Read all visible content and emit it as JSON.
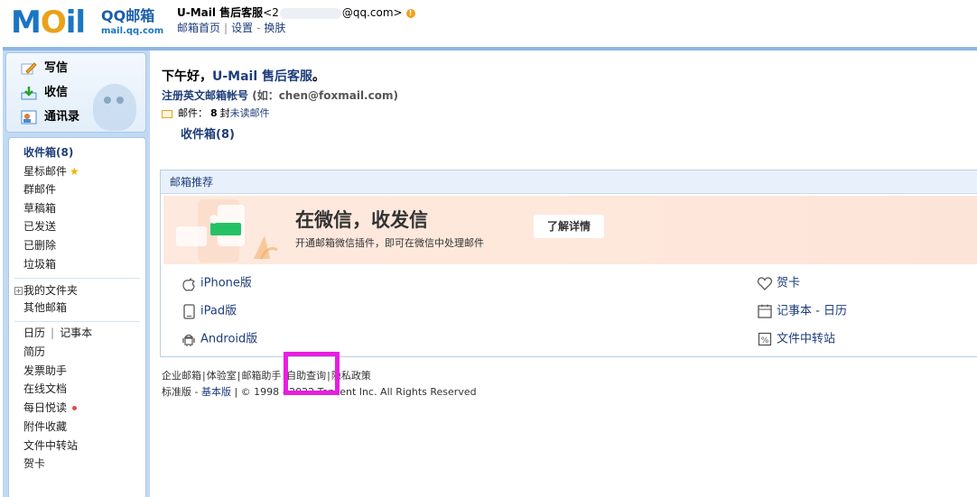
{
  "logo": {
    "letters_blue1": "M",
    "letters_o": "O",
    "letters_blue2": "il",
    "title": "QQ邮箱",
    "url": "mail.qq.com"
  },
  "account": {
    "name": "U-Mail 售后客服",
    "email_prefix": "<2",
    "email_suffix": "@qq.com>"
  },
  "header_links": [
    "邮箱首页",
    "设置",
    "换肤"
  ],
  "nav_top": {
    "compose": "写信",
    "receive": "收信",
    "contacts": "通讯录"
  },
  "nav_list": {
    "inbox": "收件箱(8)",
    "starred": "星标邮件",
    "group": "群邮件",
    "drafts": "草稿箱",
    "sent": "已发送",
    "deleted": "已删除",
    "spam": "垃圾箱",
    "my_folders": "我的文件夹",
    "other_mail": "其他邮箱",
    "calendar": "日历",
    "notes": "记事本",
    "resume": "简历",
    "invoice": "发票助手",
    "online_docs": "在线文档",
    "daily_read": "每日悦读",
    "attachments": "附件收藏",
    "file_transfer": "文件中转站",
    "cards": "贺卡"
  },
  "main": {
    "greeting_prefix": "下午好，",
    "greeting_name": "U-Mail 售后客服",
    "greeting_suffix": "。",
    "register": "注册英文邮箱帐号",
    "register_hint": "(如：chen@foxmail.com)",
    "mail_label": "邮件：",
    "mail_count": "8",
    "mail_unit": "封",
    "mail_unread": "未读邮件",
    "inbox_link": "收件箱(8)"
  },
  "recommend": {
    "header": "邮箱推荐",
    "banner_title": "在微信，收发信",
    "banner_sub": "开通邮箱微信插件，即可在微信中处理邮件",
    "banner_button": "了解详情",
    "items_left": [
      "iPhone版",
      "iPad版",
      "Android版"
    ],
    "items_right": [
      "贺卡",
      "记事本 - 日历",
      "文件中转站"
    ]
  },
  "footer": {
    "links": [
      "企业邮箱",
      "体验室",
      "邮箱助手",
      "自助查询",
      "隐私政策"
    ],
    "version_std": "标准版",
    "version_basic": "基本版",
    "copyright": "| © 1998 - 2022 Tencent Inc. All Rights Reserved"
  },
  "colors": {
    "accent": "#1e3d7a",
    "frame": "#c2d9f2",
    "highlight": "#e81ee0"
  }
}
